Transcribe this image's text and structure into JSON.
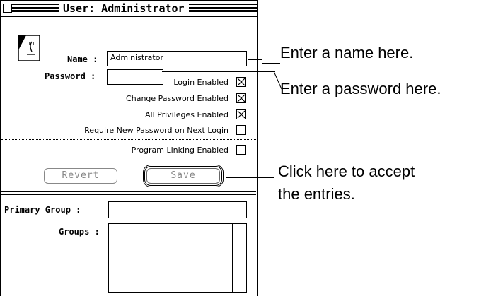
{
  "window": {
    "title": "User: Administrator"
  },
  "form": {
    "name_label": "Name :",
    "name_value": "Administrator",
    "password_label": "Password :",
    "password_value": "",
    "options": [
      {
        "label": "Login Enabled",
        "checked": true
      },
      {
        "label": "Change Password Enabled",
        "checked": true
      },
      {
        "label": "All Privileges Enabled",
        "checked": true
      },
      {
        "label": "Require New Password on Next Login",
        "checked": false
      },
      {
        "label": "Program Linking Enabled",
        "checked": false
      }
    ],
    "revert_label": "Revert",
    "save_label": "Save",
    "primary_group_label": "Primary Group :",
    "primary_group_value": "",
    "groups_label": "Groups :"
  },
  "callouts": {
    "name": "Enter a name here.",
    "password": "Enter a password here.",
    "save_line1": "Click here to accept",
    "save_line2": "the entries."
  },
  "icons": [
    "close-box-icon",
    "user-face-icon",
    "checkbox-checked-icon",
    "checkbox-empty-icon"
  ]
}
